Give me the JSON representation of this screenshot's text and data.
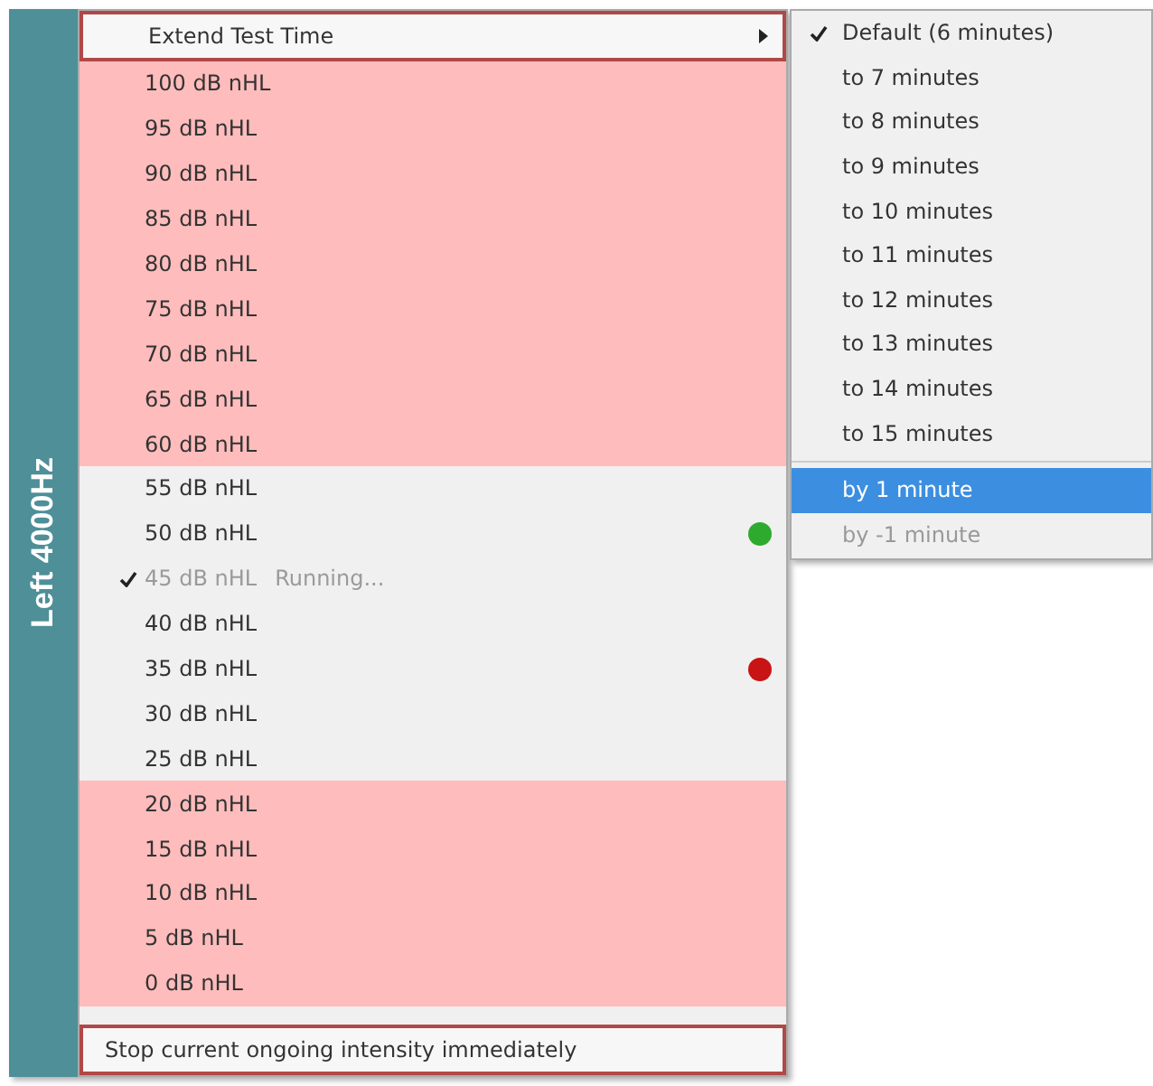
{
  "side_label": "Left 4000Hz",
  "menu": {
    "header": {
      "label": "Extend Test Time",
      "selected": true,
      "has_submenu": true
    },
    "items": [
      {
        "label": "100 dB nHL",
        "shaded": true,
        "checked": false,
        "disabled": false
      },
      {
        "label": "95 dB nHL",
        "shaded": true,
        "checked": false,
        "disabled": false
      },
      {
        "label": "90 dB nHL",
        "shaded": true,
        "checked": false,
        "disabled": false
      },
      {
        "label": "85 dB nHL",
        "shaded": true,
        "checked": false,
        "disabled": false
      },
      {
        "label": "80 dB nHL",
        "shaded": true,
        "checked": false,
        "disabled": false
      },
      {
        "label": "75 dB nHL",
        "shaded": true,
        "checked": false,
        "disabled": false
      },
      {
        "label": "70 dB nHL",
        "shaded": true,
        "checked": false,
        "disabled": false
      },
      {
        "label": "65 dB nHL",
        "shaded": true,
        "checked": false,
        "disabled": false
      },
      {
        "label": "60 dB nHL",
        "shaded": true,
        "checked": false,
        "disabled": false
      },
      {
        "label": "55 dB nHL",
        "shaded": false,
        "checked": false,
        "disabled": false
      },
      {
        "label": "50 dB nHL",
        "shaded": false,
        "checked": false,
        "disabled": false,
        "color": "#2eaa2e"
      },
      {
        "label": "45 dB nHL",
        "shaded": false,
        "checked": true,
        "disabled": true,
        "status": "Running..."
      },
      {
        "label": "40 dB nHL",
        "shaded": false,
        "checked": false,
        "disabled": false
      },
      {
        "label": "35 dB nHL",
        "shaded": false,
        "checked": false,
        "disabled": false,
        "color": "#c81414"
      },
      {
        "label": "30 dB nHL",
        "shaded": false,
        "checked": false,
        "disabled": false
      },
      {
        "label": "25 dB nHL",
        "shaded": false,
        "checked": false,
        "disabled": false
      },
      {
        "label": "20 dB nHL",
        "shaded": true,
        "checked": false,
        "disabled": false
      },
      {
        "label": "15 dB nHL",
        "shaded": true,
        "checked": false,
        "disabled": false
      },
      {
        "label": "10 dB nHL",
        "shaded": true,
        "checked": false,
        "disabled": false
      },
      {
        "label": "5 dB nHL",
        "shaded": true,
        "checked": false,
        "disabled": false
      },
      {
        "label": "0 dB nHL",
        "shaded": true,
        "checked": false,
        "disabled": false
      }
    ],
    "footer": {
      "label": "Stop current ongoing intensity immediately",
      "selected": true
    }
  },
  "submenu": {
    "items": [
      {
        "label": "Default (6 minutes)",
        "checked": true
      },
      {
        "label": "to 7 minutes",
        "checked": false
      },
      {
        "label": "to 8 minutes",
        "checked": false
      },
      {
        "label": "to 9 minutes",
        "checked": false
      },
      {
        "label": "to 10 minutes",
        "checked": false
      },
      {
        "label": "to 11 minutes",
        "checked": false
      },
      {
        "label": "to 12 minutes",
        "checked": false
      },
      {
        "label": "to 13 minutes",
        "checked": false
      },
      {
        "label": "to 14 minutes",
        "checked": false
      },
      {
        "label": "to 15 minutes",
        "checked": false
      }
    ],
    "extra_items": [
      {
        "label": "by 1 minute",
        "selected": true,
        "disabled": false
      },
      {
        "label": "by -1 minute",
        "selected": false,
        "disabled": true
      }
    ]
  }
}
